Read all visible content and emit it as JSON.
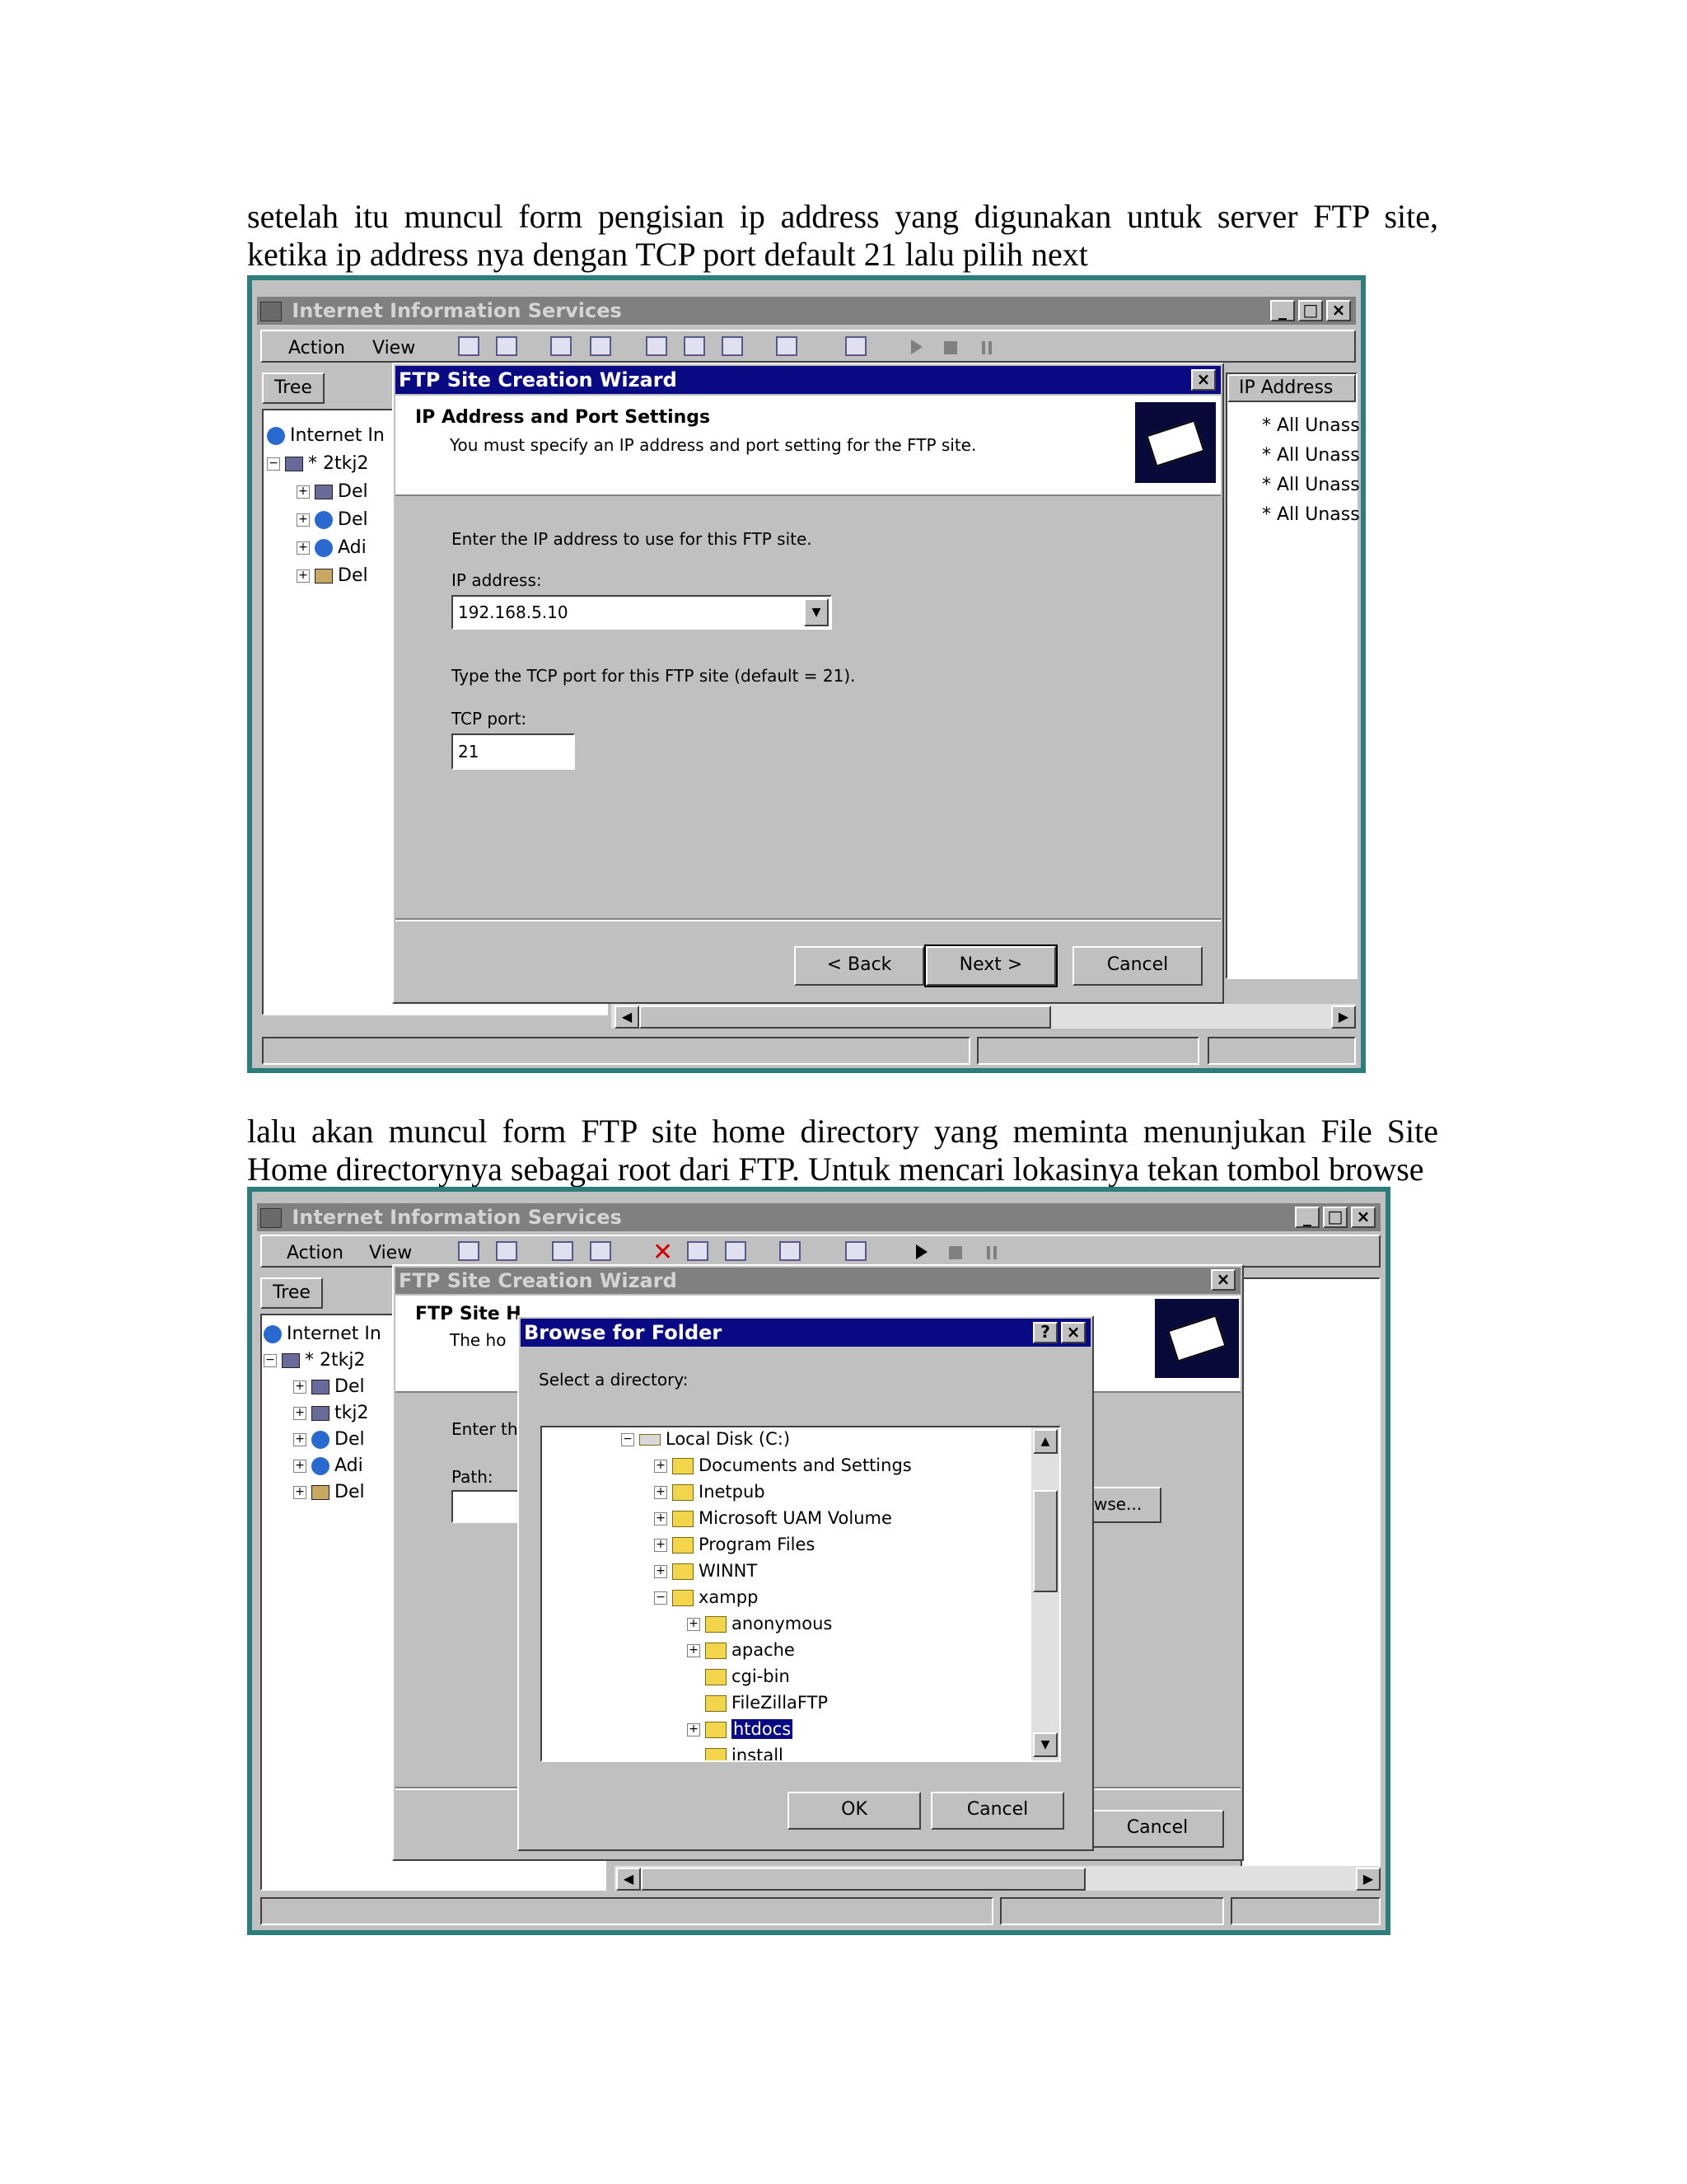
{
  "paragraphs": {
    "p1": "setelah itu muncul form pengisian ip address yang digunakan untuk server FTP site, ketika ip address nya dengan TCP port default 21 lalu pilih next",
    "p2": "lalu akan muncul form FTP site home directory yang meminta menunjukan File Site Home directorynya sebagai root dari FTP. Untuk mencari lokasinya tekan tombol browse"
  },
  "shot1": {
    "window_title": "Internet Information Services",
    "menu": [
      "Action",
      "View"
    ],
    "tree_tab": "Tree",
    "tree": [
      "Internet In",
      "* 2tkj2",
      "Del",
      "Del",
      "Adi",
      "Del"
    ],
    "column_header": "IP Address",
    "column_values": [
      "* All Unass",
      "* All Unass",
      "* All Unass",
      "* All Unass"
    ],
    "wizard": {
      "title": "FTP Site Creation Wizard",
      "heading": "IP Address and Port Settings",
      "subheading": "You must specify an IP address and port setting for the FTP site.",
      "ip_prompt": "Enter the IP address to use for this FTP site.",
      "ip_label": "IP address:",
      "ip_value": "192.168.5.10",
      "port_prompt": "Type the TCP port for this FTP site (default = 21).",
      "port_label": "TCP port:",
      "port_value": "21",
      "back": "< Back",
      "next": "Next >",
      "cancel": "Cancel"
    }
  },
  "shot2": {
    "window_title": "Internet Information Services",
    "menu": [
      "Action",
      "View"
    ],
    "tree_tab": "Tree",
    "tree": [
      "Internet In",
      "* 2tkj2",
      "Del",
      "tkj2",
      "Del",
      "Adi",
      "Del"
    ],
    "wizard": {
      "title": "FTP Site Creation Wizard",
      "heading_partial": "FTP Site H",
      "sub_partial": "The ho",
      "enter_partial": "Enter th",
      "path_label": "Path:",
      "browse_partial": "rowse...",
      "cancel": "Cancel"
    },
    "browse": {
      "title": "Browse for Folder",
      "help": "?",
      "prompt": "Select a directory:",
      "items": [
        {
          "label": "Local Disk (C:)",
          "level": 0,
          "expander": "−"
        },
        {
          "label": "Documents and Settings",
          "level": 1,
          "expander": "+"
        },
        {
          "label": "Inetpub",
          "level": 1,
          "expander": "+"
        },
        {
          "label": "Microsoft UAM Volume",
          "level": 1,
          "expander": "+"
        },
        {
          "label": "Program Files",
          "level": 1,
          "expander": "+"
        },
        {
          "label": "WINNT",
          "level": 1,
          "expander": "+"
        },
        {
          "label": "xampp",
          "level": 1,
          "expander": "−"
        },
        {
          "label": "anonymous",
          "level": 2,
          "expander": "+"
        },
        {
          "label": "apache",
          "level": 2,
          "expander": "+"
        },
        {
          "label": "cgi-bin",
          "level": 2,
          "expander": ""
        },
        {
          "label": "FileZillaFTP",
          "level": 2,
          "expander": ""
        },
        {
          "label": "htdocs",
          "level": 2,
          "expander": "+",
          "selected": true
        },
        {
          "label": "install",
          "level": 2,
          "expander": ""
        }
      ],
      "ok": "OK",
      "cancel": "Cancel"
    }
  }
}
